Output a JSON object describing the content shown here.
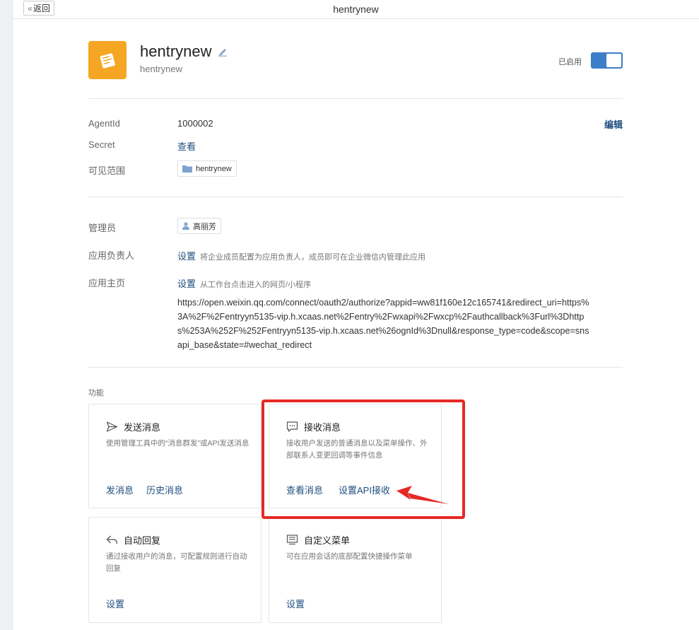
{
  "topbar": {
    "back_label": "返回",
    "title": "hentrynew"
  },
  "app": {
    "name": "hentrynew",
    "subtitle": "hentrynew",
    "status_label": "已启用"
  },
  "details": {
    "agentid_label": "AgentId",
    "agentid_value": "1000002",
    "edit_label": "编辑",
    "secret_label": "Secret",
    "secret_link": "查看",
    "scope_label": "可见范围",
    "scope_tag": "hentrynew"
  },
  "admin": {
    "admin_label": "管理员",
    "admin_tag": "高丽芳",
    "owner_label": "应用负责人",
    "owner_link": "设置",
    "owner_hint": "将企业成员配置为应用负责人，成员即可在企业微信内管理此应用",
    "home_label": "应用主页",
    "home_link": "设置",
    "home_hint": "从工作台点击进入的网页/小程序",
    "home_url": "https://open.weixin.qq.com/connect/oauth2/authorize?appid=ww81f160e12c165741&redirect_uri=https%3A%2F%2Fentryyn5135-vip.h.xcaas.net%2Fentry%2Fwxapi%2Fwxcp%2Fauthcallback%3Furl%3Dhttps%253A%252F%252Fentryyn5135-vip.h.xcaas.net%26ognId%3Dnull&response_type=code&scope=snsapi_base&state=#wechat_redirect"
  },
  "features": {
    "section_label": "功能",
    "send": {
      "title": "发送消息",
      "desc": "使用管理工具中的“消息群发”或API发送消息",
      "link1": "发消息",
      "link2": "历史消息"
    },
    "receive": {
      "title": "接收消息",
      "desc": "接收用户发送的普通消息以及菜单操作、外部联系人变更回调等事件信息",
      "link1": "查看消息",
      "link2": "设置API接收"
    },
    "auto_reply": {
      "title": "自动回复",
      "desc": "通过接收用户的消息，可配置规则进行自动回复",
      "link1": "设置"
    },
    "custom_menu": {
      "title": "自定义菜单",
      "desc": "可在应用会话的底部配置快捷操作菜单",
      "link1": "设置"
    }
  },
  "colors": {
    "accent": "#3d7ec9",
    "link": "#1f4f7e",
    "highlight": "#e52a25",
    "app_icon": "#f5a623"
  },
  "icons": [
    "back-chevron-icon",
    "edit-pencil-icon",
    "app-notepad-icon",
    "folder-icon",
    "person-icon",
    "send-plane-icon",
    "chat-bubble-icon",
    "reply-arrow-icon",
    "menu-list-icon",
    "red-arrow-annotation"
  ]
}
